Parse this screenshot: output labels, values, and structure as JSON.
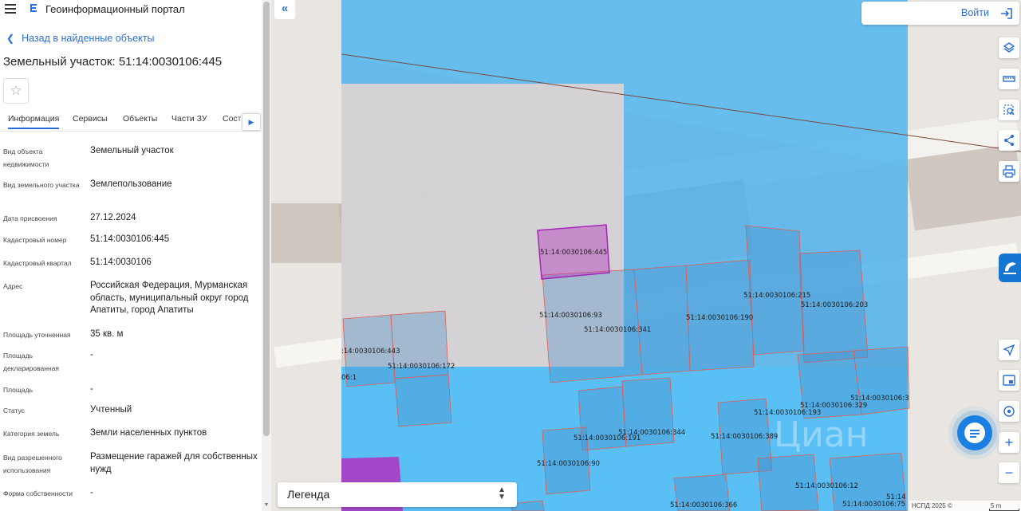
{
  "app": {
    "title": "Геоинформационный портал"
  },
  "nav": {
    "back_label": "Назад в найденные объекты"
  },
  "object": {
    "title": "Земельный участок: 51:14:0030106:445"
  },
  "tabs": [
    "Информация",
    "Сервисы",
    "Объекты",
    "Части ЗУ",
    "Состав"
  ],
  "properties": [
    {
      "label": "Вид объекта недвижимости",
      "value": "Земельный участок"
    },
    {
      "label": "Вид земельного участка",
      "value": "Землепользование"
    },
    {
      "label": "Дата присвоения",
      "value": "27.12.2024"
    },
    {
      "label": "Кадастровый номер",
      "value": "51:14:0030106:445"
    },
    {
      "label": "Кадастровый квартал",
      "value": "51:14:0030106"
    },
    {
      "label": "Адрес",
      "value": "Российская Федерация, Мурманская область, муниципальный округ город Апатиты, город Апатиты"
    },
    {
      "label": "Площадь уточненная",
      "value": "35 кв. м"
    },
    {
      "label": "Площадь декларированная",
      "value": "-"
    },
    {
      "label": "Площадь",
      "value": "-"
    },
    {
      "label": "Статус",
      "value": "Учтенный"
    },
    {
      "label": "Категория земель",
      "value": "Земли населенных пунктов"
    },
    {
      "label": "Вид разрешенного использования",
      "value": "Размещение гаражей для собственных нужд"
    },
    {
      "label": "Форма собственности",
      "value": "-"
    }
  ],
  "map": {
    "login_label": "Войти",
    "legend_label": "Легенда",
    "attribution": "НСПД 2025 ©",
    "scale_label": "5 m",
    "watermark": "Циан",
    "parcel_labels": [
      "51:14:0030106:445",
      "51:14:0030106:93",
      "51:14:0030106:341",
      "51:14:0030106:190",
      "51:14:0030106:215",
      "51:14:0030106:203",
      ":14:0030106:443",
      "51:14:0030106:172",
      "06:1",
      "51:14:0030106:3",
      "51:14:0030106:329",
      "51:14:0030106:193",
      "51:14:0030106:344",
      "51:14:0030106:191",
      "51:14:0030106:389",
      "51:14:0030106:90",
      "51:14:0030106:12",
      "51:14:0030106:366",
      "51:14:0030106:75",
      "51:14"
    ]
  },
  "colors": {
    "accent": "#2a6fd6",
    "selected_parcel": "#a326b5",
    "parcel_outline": "#e0584a",
    "quarter_fill": "#4fb2ec"
  },
  "icons": [
    "menu-icon",
    "portal-logo-icon",
    "chevron-left-icon",
    "star-icon",
    "chevron-right-icon",
    "double-chevron-left-icon",
    "login-icon",
    "layers-icon",
    "ruler-icon",
    "select-area-icon",
    "share-icon",
    "print-icon",
    "locate-icon",
    "minimap-icon",
    "geo-search-icon",
    "chat-icon"
  ]
}
